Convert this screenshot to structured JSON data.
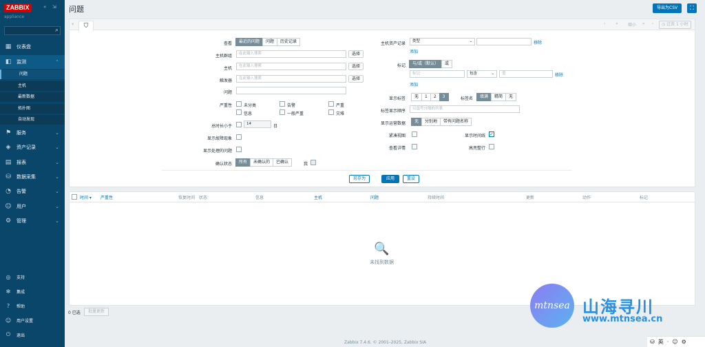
{
  "sidebar": {
    "logo": "ZABBIX",
    "appliance": "appliance",
    "collapse": "«",
    "expand": "⇲",
    "nav": [
      {
        "label": "仪表盘",
        "icon": "▦"
      },
      {
        "label": "监测",
        "icon": "◧"
      },
      {
        "label": "服务",
        "icon": "⚑"
      },
      {
        "label": "资产记录",
        "icon": "◈"
      },
      {
        "label": "报表",
        "icon": "▤"
      },
      {
        "label": "数据采集",
        "icon": "⛁"
      },
      {
        "label": "告警",
        "icon": "◔"
      },
      {
        "label": "用户",
        "icon": "☺"
      },
      {
        "label": "管理",
        "icon": "⚙"
      }
    ],
    "monitoring_sub": [
      "问题",
      "主机",
      "最新数据",
      "拓扑图",
      "自动发现"
    ],
    "bottom": [
      {
        "label": "支持",
        "icon": "◎"
      },
      {
        "label": "集成",
        "icon": "✻"
      },
      {
        "label": "帮助",
        "icon": "?"
      },
      {
        "label": "用户设置",
        "icon": "☺"
      },
      {
        "label": "退出",
        "icon": "⏻"
      }
    ]
  },
  "header": {
    "title": "问题",
    "export_label": "导出为CSV",
    "kiosk_icon": "⛶"
  },
  "filter": {
    "tab_prev": "‹",
    "tab_icon": "⛉",
    "tab_nav": [
      "‹",
      "«",
      "缩小",
      "»",
      "›"
    ],
    "time_box": "◷ 过去 1 小时",
    "view_label": "查看",
    "view_options": [
      "最近的问题",
      "问题",
      "历史记录"
    ],
    "host_group_label": "主机群组",
    "host_label": "主机",
    "trigger_label": "触发器",
    "problem_label": "问题",
    "search_placeholder": "在此输入搜索",
    "select_label": "选择",
    "severity_label": "严重性",
    "severities": [
      "未分类",
      "告警",
      "严重",
      "信息",
      "一般严重",
      "灾难"
    ],
    "age_label": "总时长小于",
    "age_value": "14",
    "age_unit": "日",
    "show_symptoms_label": "显示故障现象",
    "show_suppressed_label": "显示处理的问题",
    "ack_label": "确认状态",
    "ack_options": [
      "所有",
      "未确认的",
      "已确认"
    ],
    "ack_me_label": "我",
    "inventory_label": "主机资产记录",
    "inventory_type": "类型",
    "remove_label": "移除",
    "add_label": "添加",
    "tags_label": "标记",
    "tags_options": [
      "与/或（默认）",
      "或"
    ],
    "tag_placeholder": "标记",
    "tag_operator": "包含",
    "tag_value_placeholder": "值",
    "show_tags_label": "显示标签",
    "show_tags_options": [
      "无",
      "1",
      "2",
      "3"
    ],
    "tag_name_label": "标签名",
    "tag_name_options": [
      "填满",
      "精简",
      "无"
    ],
    "tag_priority_label": "标签显示顺序",
    "tag_priority_placeholder": "以逗号分隔的列表",
    "opdata_label": "显示运营数据",
    "opdata_options": [
      "无",
      "分别地",
      "带有问题名称"
    ],
    "compact_view_label": "紧凑视图",
    "show_timeline_label": "显示时间线",
    "show_details_label": "查看详情",
    "highlight_row_label": "高亮整行",
    "save_as_label": "另存为",
    "apply_label": "应用",
    "reset_label": "重设"
  },
  "results": {
    "columns": [
      "时间 ▾",
      "严重性",
      "恢复时间",
      "状态",
      "信息",
      "主机",
      "问题",
      "持续时间",
      "更新",
      "动作",
      "标记"
    ],
    "empty_icon": "🔍",
    "empty_text": "未找到数据",
    "selected_label": "0 已选",
    "bulk_update_label": "批量更新"
  },
  "footer": {
    "copyright": "Zabbix 7.4.6. © 2001–2025, Zabbix SIA"
  },
  "watermark": {
    "logo_text": "mtnsea",
    "cn": "山海寻川",
    "url": "www.mtnsea.cn"
  },
  "tray": [
    "⛁",
    "英",
    "·",
    "☺",
    "⚙"
  ]
}
